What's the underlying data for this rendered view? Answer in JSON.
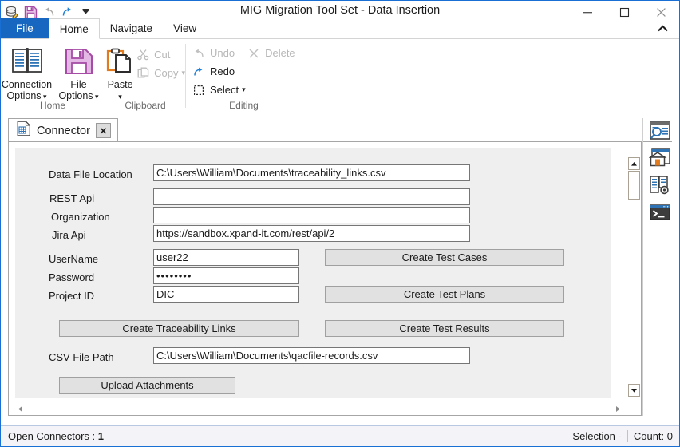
{
  "window": {
    "title": "MIG Migration Tool Set - Data Insertion",
    "minimize_label": "—",
    "maximize_label": "☐",
    "close_label": "✕"
  },
  "quick_access": [
    {
      "name": "database-edit-icon",
      "label": "Database Options"
    },
    {
      "name": "save-icon",
      "label": "Save"
    },
    {
      "name": "undo-icon",
      "label": "Undo"
    },
    {
      "name": "redo-icon",
      "label": "Redo"
    },
    {
      "name": "customize-qat-icon",
      "label": "Customize Quick Access Toolbar"
    }
  ],
  "menu_tabs": [
    {
      "label": "File",
      "state": "file"
    },
    {
      "label": "Home",
      "state": "active"
    },
    {
      "label": "Navigate",
      "state": "normal"
    },
    {
      "label": "View",
      "state": "normal"
    }
  ],
  "ribbon": {
    "collapse_icon": "chevron-up-icon",
    "groups": [
      {
        "label": "Home",
        "items": [
          {
            "label": "Connection\nOptions",
            "line1": "Connection",
            "line2": "Options",
            "icon": "book-icon",
            "dropdown": true,
            "enabled": true
          },
          {
            "label": "File\nOptions",
            "line1": "File",
            "line2": "Options",
            "icon": "floppy-save-icon",
            "dropdown": true,
            "enabled": true
          }
        ]
      },
      {
        "label": "Clipboard",
        "items": [
          {
            "label": "Paste",
            "icon": "paste-icon",
            "dropdown": true,
            "enabled": true
          },
          {
            "label": "Cut",
            "icon": "scissors-icon",
            "dropdown": false,
            "enabled": false
          },
          {
            "label": "Copy",
            "icon": "copy-icon",
            "dropdown": true,
            "enabled": false
          }
        ]
      },
      {
        "label": "Editing",
        "items": [
          {
            "label": "Undo",
            "icon": "undo-icon",
            "dropdown": false,
            "enabled": false
          },
          {
            "label": "Delete",
            "icon": "delete-x-icon",
            "dropdown": false,
            "enabled": false
          },
          {
            "label": "Redo",
            "icon": "redo-icon",
            "dropdown": false,
            "enabled": true
          },
          {
            "label": "Select",
            "icon": "select-icon",
            "dropdown": true,
            "enabled": true
          }
        ]
      }
    ]
  },
  "document_tab": {
    "icon": "connector-document-icon",
    "label": "Connector",
    "close_label": "✕"
  },
  "form": {
    "fields": [
      {
        "label": "Data File Location",
        "value": "C:\\Users\\William\\Documents\\traceability_links.csv",
        "placeholder": "",
        "type": "text"
      },
      {
        "label": "REST Api",
        "value": "",
        "placeholder": "",
        "type": "text"
      },
      {
        "label": "Organization",
        "value": "",
        "placeholder": "",
        "type": "text"
      },
      {
        "label": "Jira Api",
        "value": "https://sandbox.xpand-it.com/rest/api/2",
        "placeholder": "",
        "type": "text"
      },
      {
        "label": "UserName",
        "value": "user22",
        "placeholder": "",
        "type": "text"
      },
      {
        "label": "Password",
        "value": "••••••••",
        "placeholder": "",
        "type": "password"
      },
      {
        "label": "Project ID",
        "value": "DIC",
        "placeholder": "",
        "type": "text"
      },
      {
        "label": "CSV File Path",
        "value": "C:\\Users\\William\\Documents\\qacfile-records.csv",
        "placeholder": "",
        "type": "text"
      }
    ],
    "buttons": [
      {
        "label": "Create Test Cases"
      },
      {
        "label": "Create Test Plans"
      },
      {
        "label": "Create Traceability Links"
      },
      {
        "label": "Create Test Results"
      },
      {
        "label": "Upload Attachments"
      }
    ]
  },
  "side_rail": [
    {
      "name": "search-window-icon",
      "label": "Search"
    },
    {
      "name": "archive-bank-icon",
      "label": "Repository"
    },
    {
      "name": "book-settings-icon",
      "label": "Library Settings"
    },
    {
      "name": "console-terminal-icon",
      "label": "Console"
    }
  ],
  "scrollbars": {
    "vertical": {
      "up_label": "▲",
      "down_label": "▼"
    },
    "horizontal": {
      "left_label": "◀",
      "right_label": "▶"
    }
  },
  "status_bar": {
    "open_connectors_label": "Open Connectors :",
    "open_connectors_value": "1",
    "selection_label": "Selection -",
    "count_label": "Count: 0"
  },
  "colors": {
    "accent_blue": "#1767c0",
    "window_border": "#1a6fd4",
    "panel_bg": "#efefef",
    "button_bg": "#e1e1e1",
    "status_bg": "#f4f4f8"
  }
}
